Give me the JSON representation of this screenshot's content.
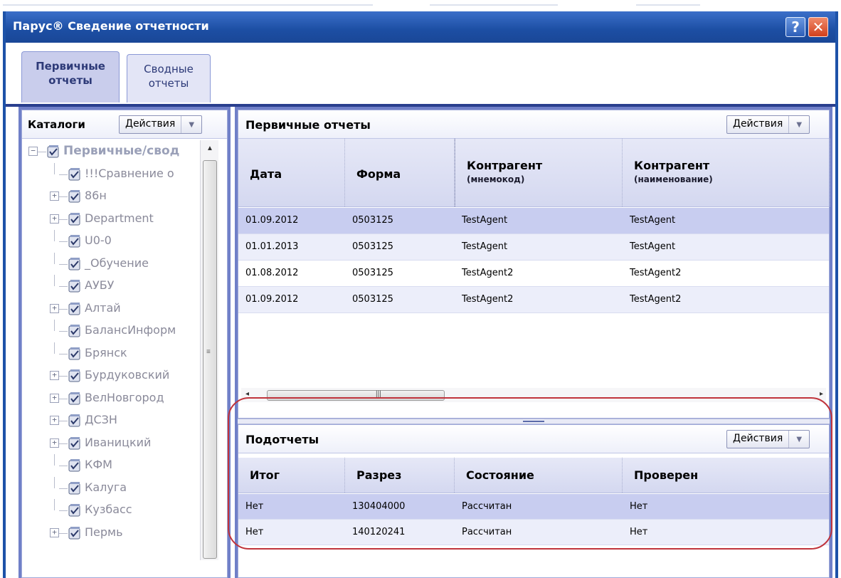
{
  "window": {
    "title": "Парус® Сведение отчетности",
    "help_label": "?",
    "close_label": "✕"
  },
  "tabs": [
    {
      "line1": "Первичные",
      "line2": "отчеты"
    },
    {
      "line1": "Сводные",
      "line2": "отчеты"
    }
  ],
  "catalog": {
    "title": "Каталоги",
    "actions_label": "Действия",
    "items": [
      {
        "label": "Первичные/свод",
        "expander": "−",
        "root": true
      },
      {
        "label": "!!!Сравнение о",
        "expander": ""
      },
      {
        "label": "86н",
        "expander": "+"
      },
      {
        "label": "Department",
        "expander": "+"
      },
      {
        "label": "U0-0",
        "expander": ""
      },
      {
        "label": "_Обучение",
        "expander": ""
      },
      {
        "label": "АУБУ",
        "expander": ""
      },
      {
        "label": "Алтай",
        "expander": "+"
      },
      {
        "label": "БалансИнформ",
        "expander": ""
      },
      {
        "label": "Брянск",
        "expander": ""
      },
      {
        "label": "Бурдуковский",
        "expander": "+"
      },
      {
        "label": "ВелНовгород",
        "expander": "+"
      },
      {
        "label": "ДСЗН",
        "expander": "+"
      },
      {
        "label": "Иваницкий",
        "expander": "+"
      },
      {
        "label": "КФМ",
        "expander": ""
      },
      {
        "label": "Калуга",
        "expander": ""
      },
      {
        "label": "Кузбасс",
        "expander": ""
      },
      {
        "label": "Пермь",
        "expander": "+"
      }
    ]
  },
  "primary": {
    "title": "Первичные отчеты",
    "actions_label": "Действия",
    "columns": [
      {
        "main": "Дата",
        "sub": ""
      },
      {
        "main": "Форма",
        "sub": ""
      },
      {
        "main": "Контрагент",
        "sub": "(мнемокод)"
      },
      {
        "main": "Контрагент",
        "sub": "(наименование)"
      }
    ],
    "rows": [
      [
        "01.09.2012",
        "0503125",
        "TestAgent",
        "TestAgent"
      ],
      [
        "01.01.2013",
        "0503125",
        "TestAgent",
        "TestAgent"
      ],
      [
        "01.08.2012",
        "0503125",
        "TestAgent2",
        "TestAgent2"
      ],
      [
        "01.09.2012",
        "0503125",
        "TestAgent2",
        "TestAgent2"
      ]
    ]
  },
  "subreports": {
    "title": "Подотчеты",
    "actions_label": "Действия",
    "columns": [
      "Итог",
      "Разрез",
      "Состояние",
      "Проверен"
    ],
    "rows": [
      [
        "Нет",
        "130404000",
        "Рассчитан",
        "Нет"
      ],
      [
        "Нет",
        "140120241",
        "Рассчитан",
        "Нет"
      ]
    ]
  },
  "colors": {
    "title_bar": "#1c4ea3",
    "selected_row": "#c8cdf0",
    "annotation": "#c0343c"
  }
}
